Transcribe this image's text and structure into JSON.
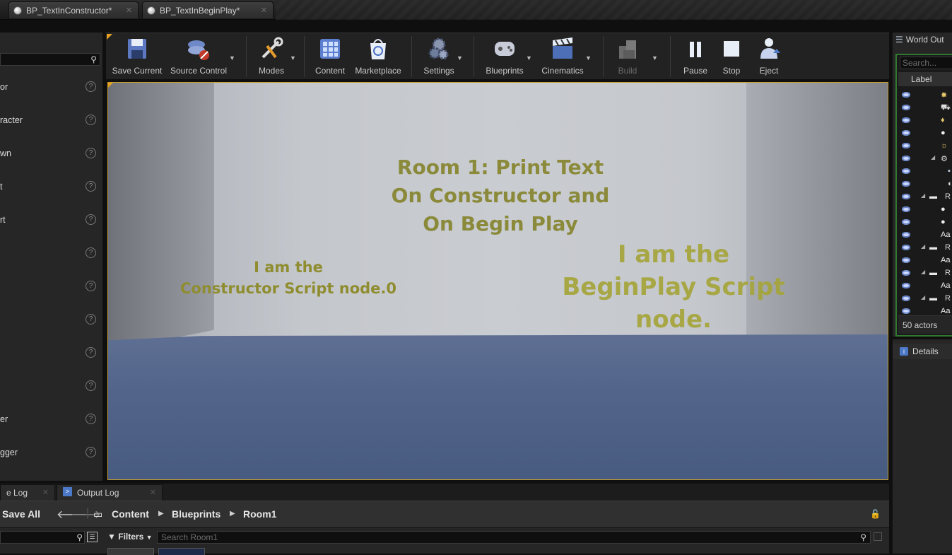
{
  "tabs": [
    {
      "label": "BP_TextInConstructor*"
    },
    {
      "label": "BP_TextInBeginPlay*"
    }
  ],
  "left_panel": {
    "items": [
      {
        "label": "or"
      },
      {
        "label": "racter"
      },
      {
        "label": "wn"
      },
      {
        "label": "t"
      },
      {
        "label": "rt"
      },
      {
        "label": ""
      },
      {
        "label": ""
      },
      {
        "label": ""
      },
      {
        "label": ""
      },
      {
        "label": ""
      },
      {
        "label": "er"
      },
      {
        "label": "gger"
      }
    ],
    "help_glyph": "?"
  },
  "toolbar": {
    "buttons": [
      {
        "label": "Save Current",
        "icon": "save-icon"
      },
      {
        "label": "Source Control",
        "icon": "source-control-icon"
      },
      {
        "label": "Modes",
        "icon": "modes-icon"
      },
      {
        "label": "Content",
        "icon": "content-icon"
      },
      {
        "label": "Marketplace",
        "icon": "marketplace-icon"
      },
      {
        "label": "Settings",
        "icon": "settings-icon"
      },
      {
        "label": "Blueprints",
        "icon": "blueprints-icon"
      },
      {
        "label": "Cinematics",
        "icon": "cinematics-icon"
      },
      {
        "label": "Build",
        "icon": "build-icon"
      },
      {
        "label": "Pause",
        "icon": "pause-icon"
      },
      {
        "label": "Stop",
        "icon": "stop-icon"
      },
      {
        "label": "Eject",
        "icon": "eject-icon"
      }
    ]
  },
  "viewport": {
    "room_title": [
      "Room 1: Print Text",
      "On Constructor and",
      "On Begin Play"
    ],
    "constructor_text": [
      "I am the",
      "Constructor Script node.0"
    ],
    "beginplay_text": [
      "I am the",
      "BeginPlay Script node."
    ]
  },
  "outliner": {
    "title": "World Out",
    "search_placeholder": "Search...",
    "column_label": "Label",
    "rows_r_label": "R",
    "actor_count": "50 actors"
  },
  "details": {
    "title": "Details"
  },
  "bottom": {
    "tabs": [
      {
        "label": "e Log"
      },
      {
        "label": "Output Log"
      }
    ],
    "save_all": "Save All",
    "breadcrumbs": [
      "Content",
      "Blueprints",
      "Room1"
    ],
    "filters_label": "Filters",
    "search_placeholder": "Search Room1"
  },
  "colors": {
    "accent": "#e8a020",
    "outliner_border": "#2f7a2f",
    "viewport_text": "#8a8a3a"
  }
}
